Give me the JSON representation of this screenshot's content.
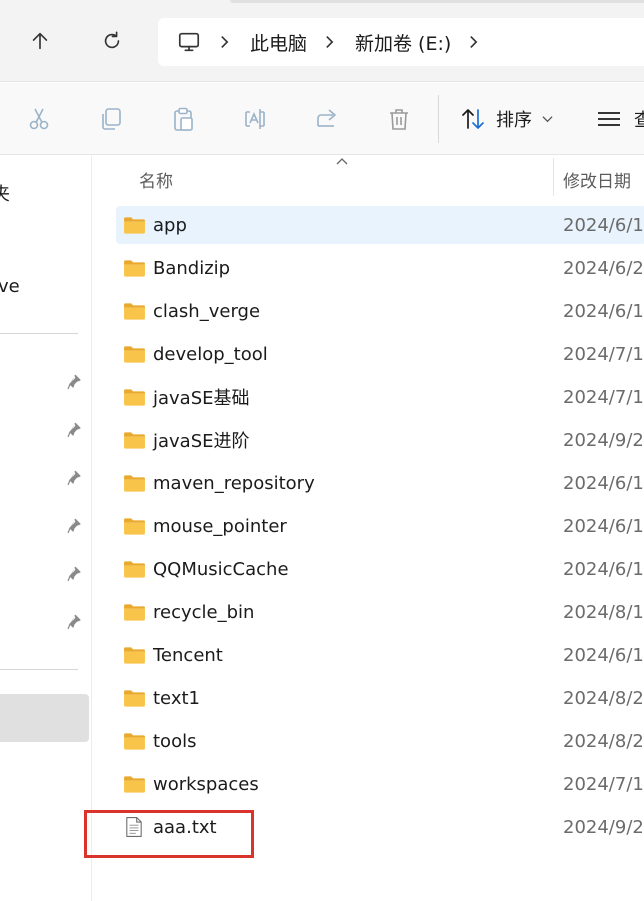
{
  "address_bar": {
    "crumbs": [
      "此电脑",
      "新加卷 (E:)"
    ]
  },
  "toolbar": {
    "sort_label": "排序",
    "view_label_fragment": "查"
  },
  "nav_pane": {
    "fragments": [
      "夹",
      "ve"
    ]
  },
  "file_list": {
    "header": {
      "name": "名称",
      "date_modified": "修改日期"
    },
    "rows": [
      {
        "name": "app",
        "type": "folder",
        "date": "2024/6/1"
      },
      {
        "name": "Bandizip",
        "type": "folder",
        "date": "2024/6/2"
      },
      {
        "name": "clash_verge",
        "type": "folder",
        "date": "2024/6/1"
      },
      {
        "name": "develop_tool",
        "type": "folder",
        "date": "2024/7/1"
      },
      {
        "name": "javaSE基础",
        "type": "folder",
        "date": "2024/7/1"
      },
      {
        "name": "javaSE进阶",
        "type": "folder",
        "date": "2024/9/2"
      },
      {
        "name": "maven_repository",
        "type": "folder",
        "date": "2024/6/1"
      },
      {
        "name": "mouse_pointer",
        "type": "folder",
        "date": "2024/6/1"
      },
      {
        "name": "QQMusicCache",
        "type": "folder",
        "date": "2024/6/1"
      },
      {
        "name": "recycle_bin",
        "type": "folder",
        "date": "2024/8/1"
      },
      {
        "name": "Tencent",
        "type": "folder",
        "date": "2024/6/1"
      },
      {
        "name": "text1",
        "type": "folder",
        "date": "2024/8/2"
      },
      {
        "name": "tools",
        "type": "folder",
        "date": "2024/8/2"
      },
      {
        "name": "workspaces",
        "type": "folder",
        "date": "2024/7/1"
      },
      {
        "name": "aaa.txt",
        "type": "text-file",
        "date": "2024/9/2"
      }
    ]
  },
  "colors": {
    "hover_row": "#e8f3fd",
    "folder_yellow": "#f8c54a",
    "highlight_red": "#d9342b"
  }
}
